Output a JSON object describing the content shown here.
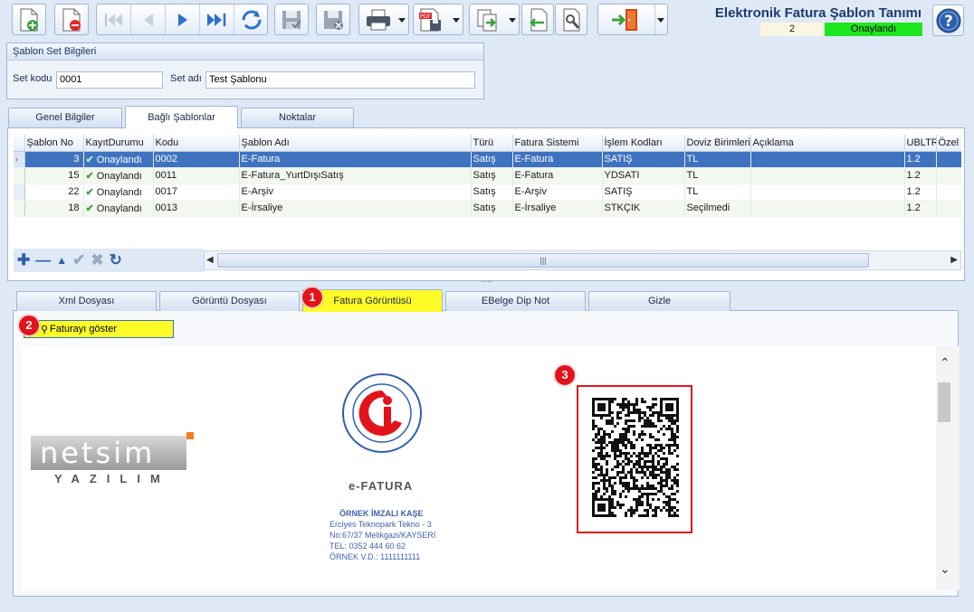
{
  "window": {
    "title": "Elektronik Fatura Şablon Tanımı",
    "record_number": "2",
    "status": "Onaylandı",
    "status_color": "#1ee61e"
  },
  "toolbar": {
    "icons": [
      "new-doc-icon",
      "delete-doc-icon",
      "first-record-icon",
      "previous-record-icon",
      "next-record-icon",
      "last-record-icon",
      "refresh-icon",
      "save-icon",
      "cancel-save-icon",
      "print-icon",
      "pdf-export-icon",
      "export-icon",
      "import-icon",
      "tools-icon",
      "exit-icon",
      "help-icon"
    ]
  },
  "set_group": {
    "title": "Şablon Set Bilgileri",
    "code_label": "Set kodu",
    "code_value": "0001",
    "name_label": "Set adı",
    "name_value": "Test Şablonu"
  },
  "top_tabs": [
    {
      "label": "Genel Bilgiler"
    },
    {
      "label": "Bağlı Şablonlar"
    },
    {
      "label": "Noktalar"
    }
  ],
  "grid": {
    "columns": [
      "Şablon No",
      "KayıtDurumu",
      "Kodu",
      "Şablon Adı",
      "Türü",
      "Fatura Sistemi",
      "İşlem Kodları",
      "Doviz Birimleri",
      "Açıklama",
      "UBLTR",
      "Özel F"
    ],
    "rows": [
      {
        "no": "3",
        "status": "Onaylandı",
        "code": "0002",
        "name": "E-Fatura",
        "type": "Satış",
        "system": "E-Fatura",
        "ops": "SATIŞ",
        "currency": "TL",
        "desc": "",
        "ubl": "1.2"
      },
      {
        "no": "15",
        "status": "Onaylandı",
        "code": "0011",
        "name": "E-Fatura_YurtDışıSatış",
        "type": "Satış",
        "system": "E-Fatura",
        "ops": "YDSATI",
        "currency": "TL",
        "desc": "",
        "ubl": "1.2"
      },
      {
        "no": "22",
        "status": "Onaylandı",
        "code": "0017",
        "name": "E-Arşiv",
        "type": "Satış",
        "system": "E-Arşiv",
        "ops": "SATIŞ",
        "currency": "TL",
        "desc": "",
        "ubl": "1.2"
      },
      {
        "no": "18",
        "status": "Onaylandı",
        "code": "0013",
        "name": "E-İrsaliye",
        "type": "Satış",
        "system": "E-İrsaliye",
        "ops": "STKÇIK",
        "currency": "Seçilmedi",
        "desc": "",
        "ubl": "1.2"
      }
    ]
  },
  "bottom_tabs": [
    {
      "label": "Xml Dosyası"
    },
    {
      "label": "Görüntü Dosyası"
    },
    {
      "label": "Fatura Görüntüsü"
    },
    {
      "label": "EBelge Dip Not"
    },
    {
      "label": "Gizle"
    }
  ],
  "show_invoice_button": "Faturayı göster",
  "badges": [
    "1",
    "2",
    "3"
  ],
  "invoice": {
    "logo_word": "netsim",
    "logo_sub": "YAZILIM",
    "efatura_label": "e-FATURA",
    "seal_lines": [
      "ÖRNEK İMZALI KAŞE",
      "Erciyes Teknopark Tekno - 3",
      "No:67/37 Melikgazi/KAYSERİ",
      "TEL: 0352 444 60 62",
      "ÖRNEK V.D.: 1111111111"
    ]
  }
}
